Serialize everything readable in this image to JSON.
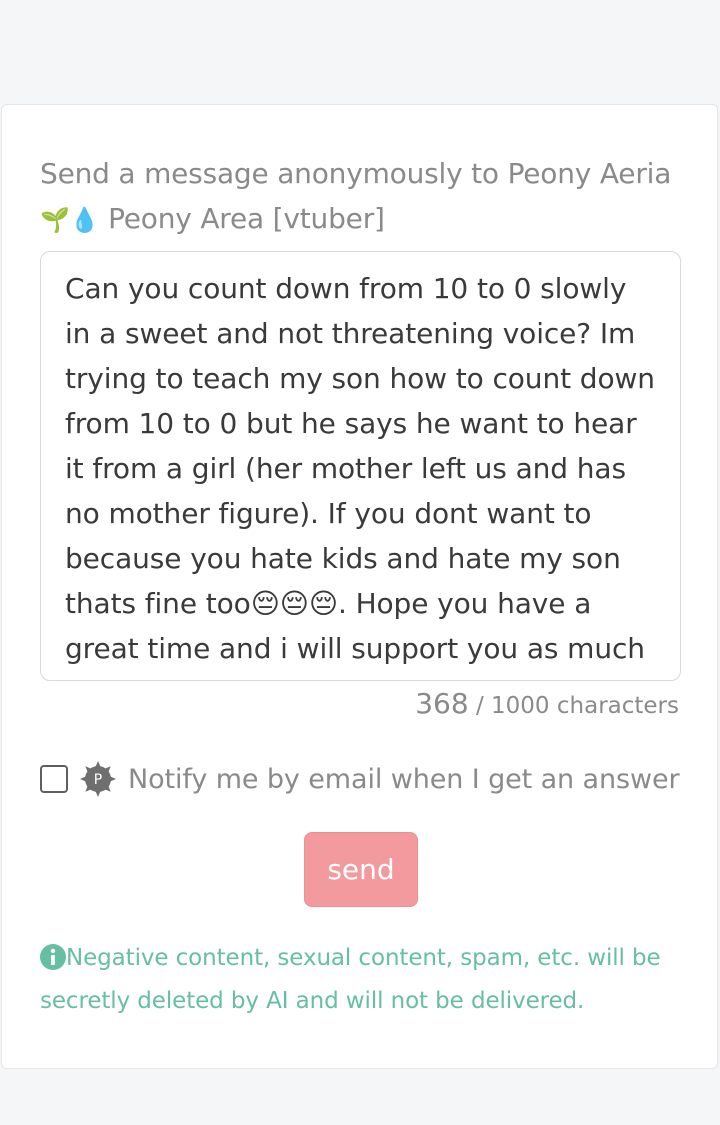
{
  "form": {
    "title": "Send a message anonymously to Peony Aeria",
    "title_emoji": "🌱💧",
    "title_line2": " Peony Area [vtuber]",
    "message": "Can you count down from 10 to 0 slowly in a sweet and not threatening voice? Im trying to teach my son how to count down from 10 to 0 but he says he want to hear it from a girl (her mother left us and has no mother figure). If you dont want to because you hate kids and hate my son thats fine too😔😔😔. Hope you have a great time and i will support you as much as i can.",
    "char_count": "368",
    "char_separator": " / ",
    "char_max": "1000 characters",
    "notify_label": "Notify me by email when I get an answer",
    "notify_checked": false,
    "badge_letter": "P",
    "send_label": "send",
    "notice": "Negative content, sexual content, spam, etc. will be secretly deleted by AI and will not be delivered."
  },
  "colors": {
    "page_bg": "#f5f6f8",
    "send_button": "#f29a9d",
    "notice_text": "#66bfa0",
    "muted_text": "#8a8a8a"
  },
  "icons": {
    "badge": "gear-badge-p-icon",
    "info": "info-circle-icon"
  }
}
